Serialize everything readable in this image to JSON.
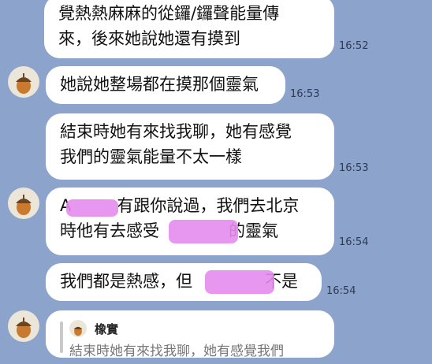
{
  "messages": [
    {
      "lines": [
        "覺熱熱麻麻的從鑼/鑼聲能量傳",
        "來，後來她說她還有摸到"
      ],
      "time": "16:52"
    },
    {
      "lines": [
        "她說她整場都在摸那個靈氣"
      ],
      "time": "16:53"
    },
    {
      "lines": [
        "結束時她有來找我聊，她有感覺",
        "我們的靈氣能量不太一樣"
      ],
      "time": "16:53"
    },
    {
      "lines": [
        "A",
        "有跟你說過，我們去北京",
        "時他有去感受",
        "的靈氣"
      ],
      "time": "16:54"
    },
    {
      "lines": [
        "我們都是熱感，但",
        "不是"
      ],
      "time": "16:54"
    },
    {
      "reply_name": "橡實",
      "reply_text": "結束時她有來找我聊，她有感覺我們"
    }
  ],
  "colors": {
    "background": "#8ca3cc",
    "bubble": "#ffffff",
    "redaction": "#e58cf0"
  },
  "icons": {
    "avatar": "acorn-icon"
  }
}
